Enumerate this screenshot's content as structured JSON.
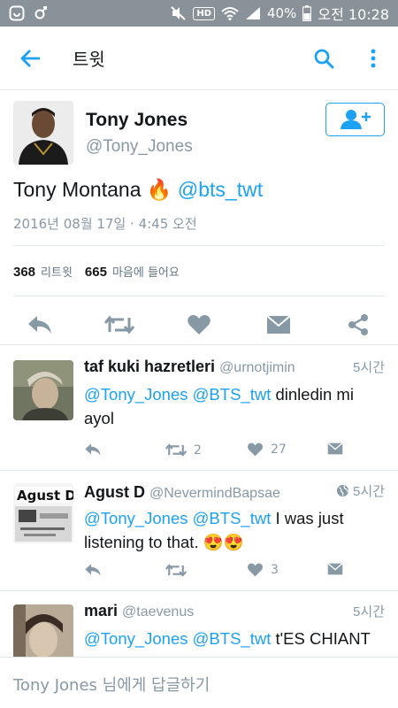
{
  "statusbar": {
    "hd": "HD",
    "battery": "40%",
    "time": "오전 10:28"
  },
  "appbar": {
    "title": "트윗"
  },
  "main_tweet": {
    "name": "Tony Jones",
    "handle": "@Tony_Jones",
    "text": "Tony Montana 🔥",
    "mention": "@bts_twt",
    "date": "2016년 08월 17일 · 4:45 오전",
    "retweets": "368",
    "retweets_label": "리트윗",
    "likes": "665",
    "likes_label": "마음에 들어요"
  },
  "replies": [
    {
      "name": "taf kuki hazretleri",
      "handle": "@urnotjimin",
      "time": "5시간",
      "mention1": "@Tony_Jones",
      "mention2": "@BTS_twt",
      "text": " dinledin mi ayol",
      "retweets": "2",
      "likes": "27"
    },
    {
      "name": "Agust D",
      "handle": "@NevermindBapsae",
      "time": "5시간",
      "avatar_text": "Agust D",
      "mention1": "@Tony_Jones",
      "mention2": "@BTS_twt",
      "text": " I was just listening to that. 😍😍",
      "retweets": "",
      "likes": "3"
    },
    {
      "name": "mari",
      "handle": "@taevenus",
      "time": "5시간",
      "mention1": "@Tony_Jones",
      "mention2": "@BTS_twt",
      "text": " t'ES CHIANT"
    }
  ],
  "composer": {
    "placeholder": "Tony Jones 님에게 답글하기"
  },
  "colors": {
    "accent": "#1da1f2",
    "muted": "#8899a6",
    "statusbar": "#8a9299"
  }
}
